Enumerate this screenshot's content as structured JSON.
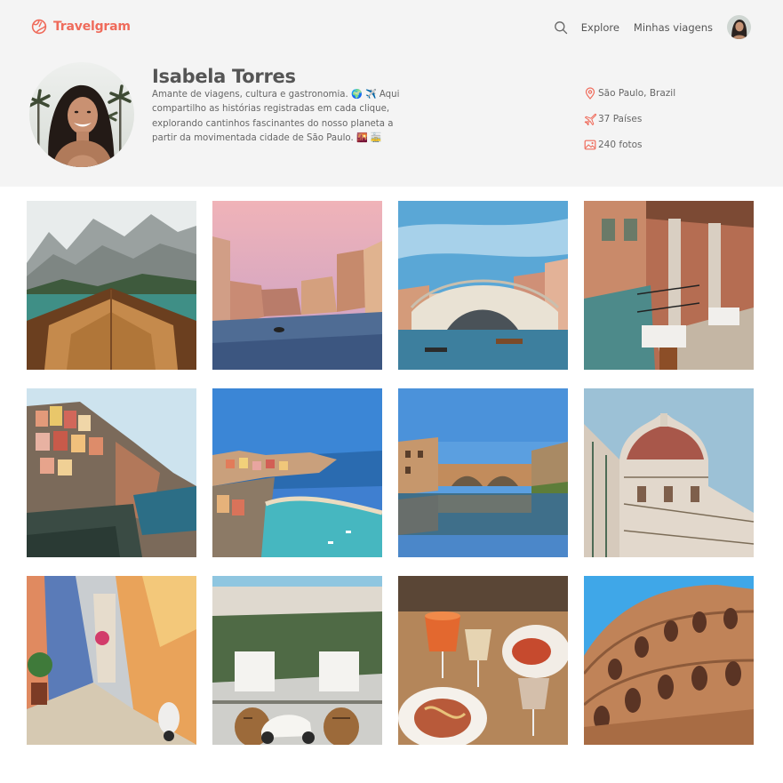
{
  "app": {
    "name": "Travelgram",
    "brand_color": "#ef6b5b",
    "logo_icon": "globe-icon"
  },
  "nav": {
    "search_icon": "search-icon",
    "links": [
      "Explore",
      "Minhas viagens"
    ],
    "avatar": "user-avatar"
  },
  "profile": {
    "name": "Isabela Torres",
    "bio": "Amante de viagens, cultura e gastronomia. 🌍 ✈️ Aqui compartilho as histórias registradas em cada clique, explorando cantinhos fascinantes do nosso planeta a partir da movimentada cidade de São Paulo. 🌇 🚋",
    "stats": [
      {
        "icon": "location-pin-icon",
        "text": "São Paulo, Brazil"
      },
      {
        "icon": "airplane-icon",
        "text": "37 Países"
      },
      {
        "icon": "image-icon",
        "text": "240 fotos"
      }
    ]
  },
  "gallery": [
    {
      "subject": "mountain-lake-boat"
    },
    {
      "subject": "venice-canal-dusk"
    },
    {
      "subject": "venice-rialto-bridge"
    },
    {
      "subject": "venice-canal-terrace-restaurant"
    },
    {
      "subject": "cinque-terre-cliff-village"
    },
    {
      "subject": "cinque-terre-harbor-aerial"
    },
    {
      "subject": "florence-ponte-vecchio"
    },
    {
      "subject": "florence-cathedral-dome"
    },
    {
      "subject": "colorful-alley-vespa"
    },
    {
      "subject": "cafe-vespa-wine-barrels"
    },
    {
      "subject": "dinner-table-spritz-pasta"
    },
    {
      "subject": "rome-colosseum"
    }
  ]
}
